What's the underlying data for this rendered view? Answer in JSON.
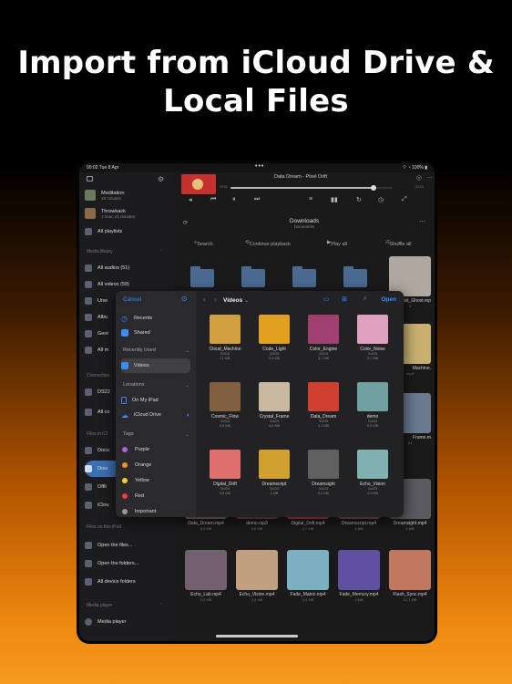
{
  "headline": {
    "line1": "Import from iCloud Drive &",
    "line2": "Local Files"
  },
  "status": {
    "time": "00:02  Tue 8 Apr",
    "dots": "•••",
    "right": "⌔ ◔ 100% ▮"
  },
  "sidebar": {
    "playlists": [
      {
        "title": "Meditation",
        "sub": "10 minutes",
        "color": "#6a7a5a"
      },
      {
        "title": "Throwback",
        "sub": "1 hour, 21 minutes",
        "color": "#8a6a4a"
      }
    ],
    "all_playlists": "All playlists",
    "media_library": "Media library",
    "library_items": [
      "All audios (51)",
      "All videos (58)",
      "Unw",
      "Albu",
      "Genr",
      "All m"
    ],
    "connections": "Connection",
    "conn_items": [
      "DS22",
      "All co"
    ],
    "files_icloud": "Files in iCl",
    "icloud_items": [
      "Docu",
      "Dow",
      "Offli",
      "iClou"
    ],
    "files_ipad": "Files on this iPad",
    "ipad_items": [
      "Open the files...",
      "Open the folders...",
      "All device folders"
    ],
    "media_player": "Media player",
    "player_item": "Media player"
  },
  "player": {
    "track": "Data Dream - Pixel Drift",
    "elapsed": "00:00",
    "remaining": "-03:01",
    "progress": 0.88
  },
  "path": {
    "title": "Downloads",
    "subtitle": "Documents"
  },
  "actions": {
    "search": "Search",
    "continue": "Continue playback",
    "play_all": "Play all",
    "shuffle": "Shuffle all"
  },
  "grid_items": [
    {
      "name": "Lost_Ghost.mp",
      "size": "4",
      "color": "#b0a8a0"
    },
    {
      "name": "Machine.",
      "size": "mp4",
      "color": "#c8b070"
    },
    {
      "name": "Frame.m",
      "size": "p4",
      "color": "#6a7a90"
    },
    {
      "name": "Data_Dream.mp4",
      "size": "3,9 MB",
      "color": "#8a7060"
    },
    {
      "name": "demo.mp3",
      "size": "3,9 MB",
      "color": "#805040"
    },
    {
      "name": "Digital_Drift.mp4",
      "size": "3,7 MB",
      "color": "#c04040"
    },
    {
      "name": "Dreamscript.mp4",
      "size": "4 MB",
      "color": "#805860"
    },
    {
      "name": "Dreamsight.mp4",
      "size": "4 MB",
      "color": "#5a5a60"
    },
    {
      "name": "Echo_Lab.mp4",
      "size": "4,3 MB",
      "color": "#706070"
    },
    {
      "name": "Echo_Vision.mp4",
      "size": "4,3 MB",
      "color": "#c0a080"
    },
    {
      "name": "Fade_Matrix.mp4",
      "size": "4,3 MB",
      "color": "#7ab0c0"
    },
    {
      "name": "Fade_Memory.mp4",
      "size": "4 MB",
      "color": "#6050a0"
    },
    {
      "name": "Flash_Sync.mp4",
      "size": "12,7 MB",
      "color": "#c07860"
    }
  ],
  "picker": {
    "cancel": "Cancel",
    "title": "Videos",
    "open": "Open",
    "recents": "Recents",
    "shared": "Shared",
    "recently_used": "Recently Used",
    "videos": "Videos",
    "locations": "Locations",
    "on_my_ipad": "On My iPad",
    "icloud_drive": "iCloud Drive",
    "tags": "Tags",
    "tag_items": [
      {
        "name": "Purple",
        "color": "#b060e0"
      },
      {
        "name": "Orange",
        "color": "#f09030"
      },
      {
        "name": "Yellow",
        "color": "#f0d030"
      },
      {
        "name": "Red",
        "color": "#f04040"
      },
      {
        "name": "Important",
        "color": "#999999"
      }
    ],
    "files": [
      {
        "name": "Cloud_Machine",
        "date": "3/4/25",
        "size": "11 MB",
        "color": "#d0a040"
      },
      {
        "name": "Code_Light",
        "date": "3/4/25",
        "size": "3,9 MB",
        "color": "#e0a020"
      },
      {
        "name": "Color_Engine",
        "date": "3/4/25",
        "size": "3,7 MB",
        "color": "#a04070"
      },
      {
        "name": "Color_Noise",
        "date": "3/4/25",
        "size": "5,7 MB",
        "color": "#e0a0c0"
      },
      {
        "name": "Cosmic_Flow",
        "date": "3/4/25",
        "size": "6,8 MB",
        "color": "#806040"
      },
      {
        "name": "Crystal_Frame",
        "date": "3/4/25",
        "size": "4,6 MB",
        "color": "#c8b8a0"
      },
      {
        "name": "Data_Dream",
        "date": "3/4/25",
        "size": "4,1 MB",
        "color": "#d04030"
      },
      {
        "name": "demo",
        "date": "3/4/25",
        "size": "5,5 MB",
        "color": "#70a0a0"
      },
      {
        "name": "Digital_Drift",
        "date": "3/4/25",
        "size": "3,9 MB",
        "color": "#e07070"
      },
      {
        "name": "Dreamscript",
        "date": "3/4/25",
        "size": "4 MB",
        "color": "#d0a030"
      },
      {
        "name": "Dreamsight",
        "date": "3/4/25",
        "size": "4,2 MB",
        "color": "#606060"
      },
      {
        "name": "Echo_Vision",
        "date": "3/4/25",
        "size": "4,3 MB",
        "color": "#80b0b0"
      }
    ]
  }
}
